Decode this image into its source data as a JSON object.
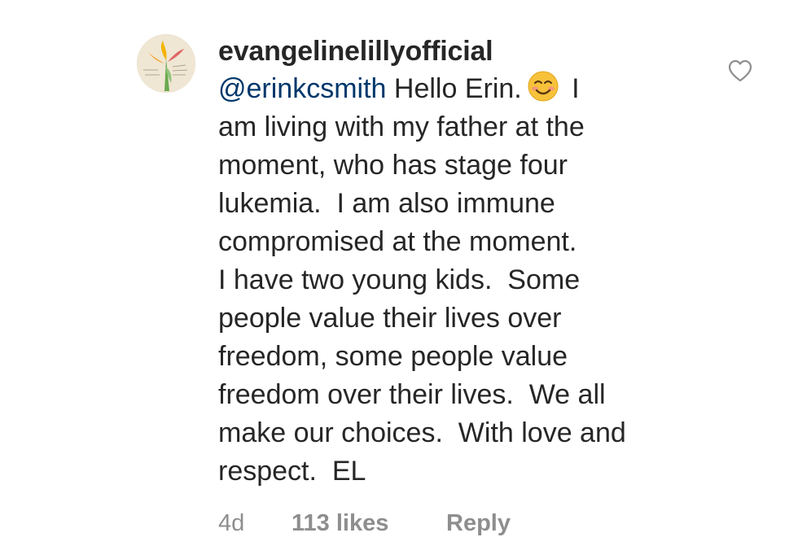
{
  "comment": {
    "username": "evangelinelillyofficial",
    "mention": "@erinkcsmith",
    "lines": [
      " Hello Erin.",
      " I",
      "am living with my father at the",
      "moment, who has stage four",
      "lukemia.  I am also immune",
      "compromised at the moment.",
      "I have two young kids.  Some",
      "people value their lives over",
      "freedom, some people value",
      "freedom over their lives.  We all",
      "make our choices.  With love and",
      "respect.  EL"
    ],
    "emoji": "smiling-face-icon",
    "time": "4d",
    "likes": "113 likes",
    "reply_label": "Reply"
  },
  "icons": {
    "like": "heart-outline-icon",
    "avatar": "profile-avatar-image"
  },
  "colors": {
    "text": "#262626",
    "mention": "#00376b",
    "meta": "#8e8e8e",
    "emoji_face": "#f7c23a"
  }
}
